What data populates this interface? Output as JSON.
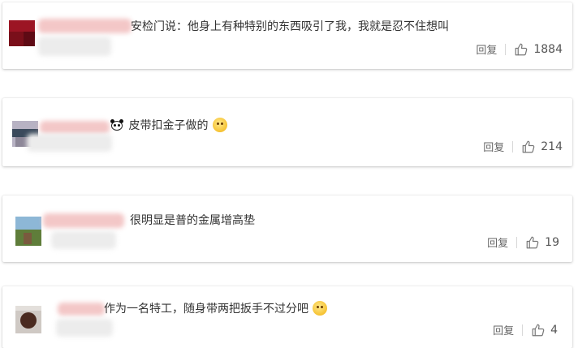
{
  "comments": [
    {
      "text": "安检门说：他身上有种特别的东西吸引了我，我就是忍不住想叫",
      "reply_label": "回复",
      "like_count": "1884",
      "like_icon": "thumbs-up-icon",
      "avatar_colors": [
        "#7a0f1a",
        "#b01e2c"
      ]
    },
    {
      "text": "皮带扣金子做的",
      "reply_label": "回复",
      "like_count": "214",
      "like_icon": "thumbs-up-icon",
      "emoji": [
        "panda-emoji-icon",
        "doge-emoji-icon"
      ],
      "avatar_colors": [
        "#3b4a5c",
        "#b7b2c3"
      ]
    },
    {
      "text": "很明显是普的金属增高垫",
      "reply_label": "回复",
      "like_count": "19",
      "like_icon": "thumbs-up-icon",
      "avatar_colors": [
        "#5f7d3a",
        "#8db7d6"
      ]
    },
    {
      "text": "作为一名特工，随身带两把扳手不过分吧",
      "reply_label": "回复",
      "like_count": "4",
      "like_icon": "thumbs-up-icon",
      "emoji": [
        "grin-emoji-icon"
      ],
      "avatar_colors": [
        "#4a2a20",
        "#cfc9c4"
      ]
    }
  ]
}
